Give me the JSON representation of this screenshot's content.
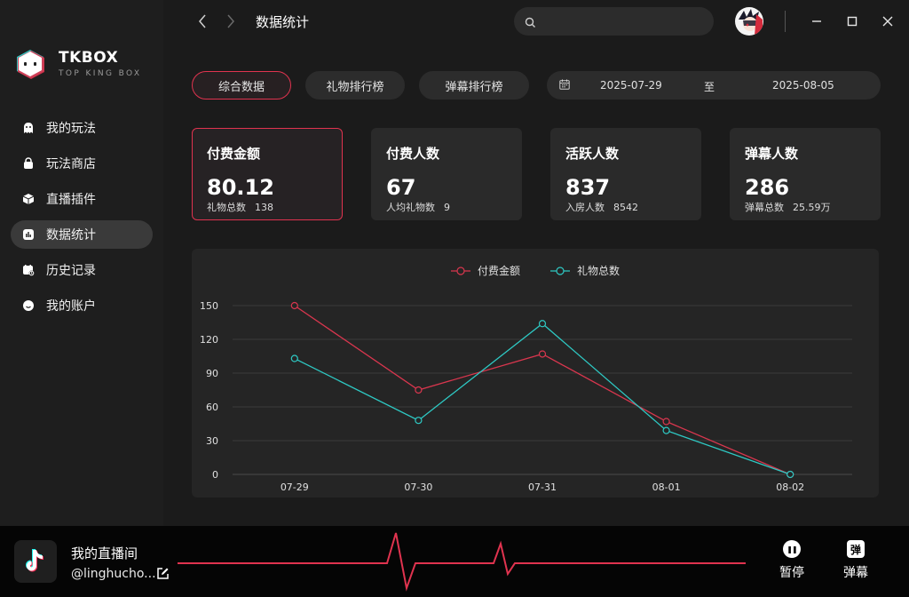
{
  "app": {
    "name": "TKBOX",
    "tagline": "TOP KING BOX"
  },
  "sidebar": {
    "items": [
      {
        "label": "我的玩法",
        "icon": "ghost-icon"
      },
      {
        "label": "玩法商店",
        "icon": "shopping-bag-icon"
      },
      {
        "label": "直播插件",
        "icon": "cube-icon"
      },
      {
        "label": "数据统计",
        "icon": "bar-chart-icon",
        "active": true
      },
      {
        "label": "历史记录",
        "icon": "calendar-clock-icon"
      },
      {
        "label": "我的账户",
        "icon": "smile-icon"
      }
    ]
  },
  "topbar": {
    "title": "数据统计",
    "search_placeholder": ""
  },
  "tabs": [
    {
      "label": "综合数据",
      "active": true
    },
    {
      "label": "礼物排行榜"
    },
    {
      "label": "弹幕排行榜"
    }
  ],
  "date_range": {
    "start": "2025-07-29",
    "separator": "至",
    "end": "2025-08-05"
  },
  "cards": [
    {
      "title": "付费金额",
      "value": "80.12",
      "sub_label": "礼物总数",
      "sub_value": "138",
      "active": true
    },
    {
      "title": "付费人数",
      "value": "67",
      "sub_label": "人均礼物数",
      "sub_value": "9"
    },
    {
      "title": "活跃人数",
      "value": "837",
      "sub_label": "入房人数",
      "sub_value": "8542"
    },
    {
      "title": "弹幕人数",
      "value": "286",
      "sub_label": "弹幕总数",
      "sub_value": "25.59万"
    }
  ],
  "chart_data": {
    "type": "line",
    "categories": [
      "07-29",
      "07-30",
      "07-31",
      "08-01",
      "08-02"
    ],
    "series": [
      {
        "name": "付费金额",
        "values": [
          150,
          75,
          107,
          47,
          0
        ],
        "color": "#d9364e"
      },
      {
        "name": "礼物总数",
        "values": [
          103,
          48,
          134,
          39,
          0
        ],
        "color": "#2ec9c4"
      }
    ],
    "yticks": [
      0,
      30,
      60,
      90,
      120,
      150
    ],
    "ylim": [
      0,
      150
    ],
    "legend": "top-center",
    "grid": true
  },
  "footer": {
    "room_title": "我的直播间",
    "handle": "@linghucho...",
    "pause_label": "暂停",
    "pause_glyph": "❚❚",
    "danmu_label": "弹幕",
    "danmu_glyph": "弹"
  },
  "colors": {
    "accent": "#e0334f",
    "teal": "#2ec9c4"
  }
}
